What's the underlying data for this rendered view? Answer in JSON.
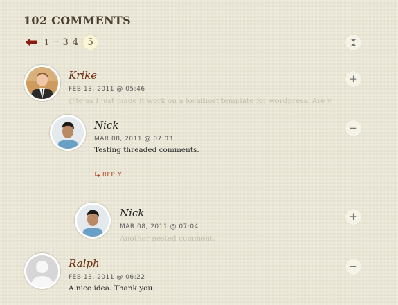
{
  "comments_header": {
    "title": "102 COMMENTS"
  },
  "pagination": {
    "prev_icon": "left-arrow-icon",
    "pages": [
      "1",
      "3",
      "4"
    ],
    "ellipsis": "···",
    "current": "5"
  },
  "comments": [
    {
      "author": "Krike",
      "date": "FEB 13, 2011 @ 05:46",
      "text": "@tejas I just made it work on a localhost template for wordpress. Are you",
      "toggle": "+"
    },
    {
      "author": "Nick",
      "date": "MAR 08, 2011 @ 07:03",
      "text": "Testing threaded comments.",
      "toggle": "−",
      "reply_label": "REPLY"
    },
    {
      "author": "Nick",
      "date": "MAR 08, 2011 @ 07:04",
      "text": "Another nested comment.",
      "toggle": "+"
    },
    {
      "author": "Ralph",
      "date": "FEB 13, 2011 @ 06:22",
      "text": "A nice idea. Thank you.",
      "toggle": "−"
    }
  ],
  "colors": {
    "background": "#ebe7d6",
    "author_link": "#6e2f10",
    "reply_link": "#b33b1a",
    "arrow": "#8a1a10"
  }
}
